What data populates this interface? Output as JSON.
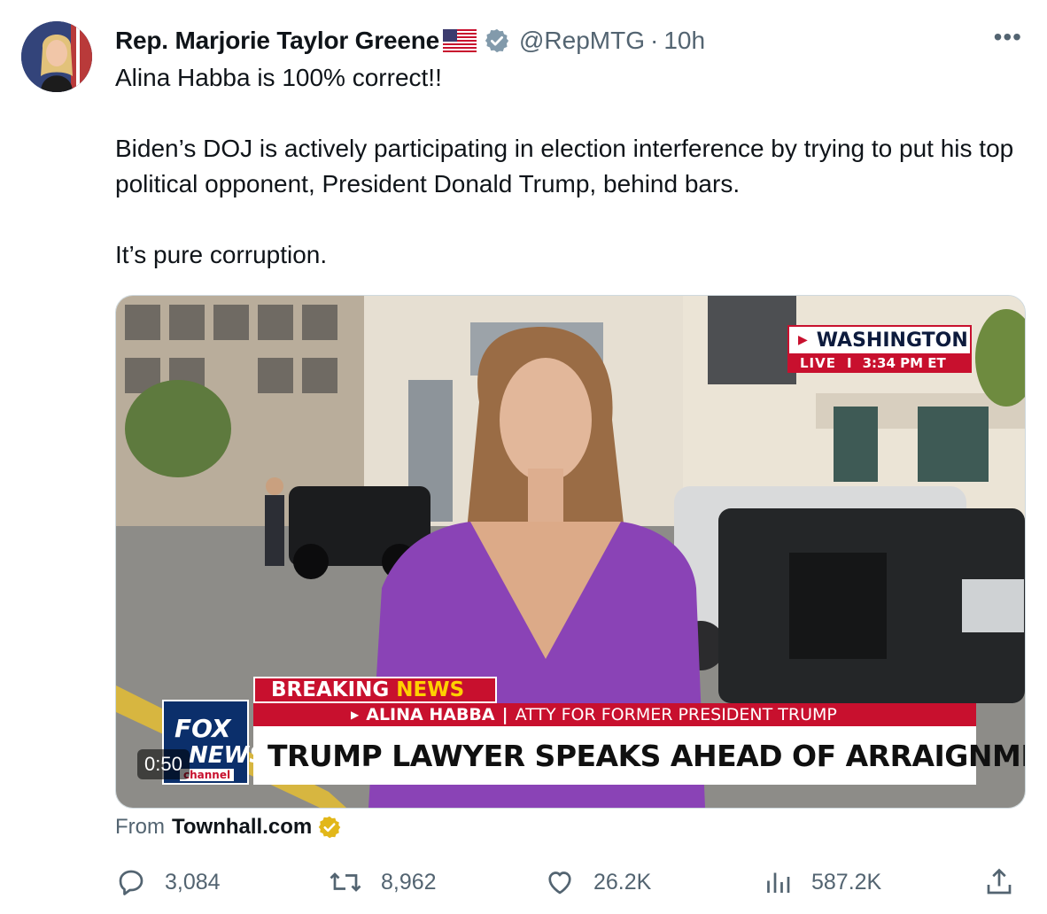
{
  "tweet": {
    "author_name": "Rep. Marjorie Taylor Greene",
    "handle": "@RepMTG",
    "separator": "·",
    "time": "10h",
    "more_label": "•••",
    "lines": [
      "Alina Habba is 100% correct!!",
      "Biden’s DOJ is actively participating in election interference by trying to put his top political opponent, President Donald Trump, behind bars.",
      "It’s pure corruption."
    ]
  },
  "video": {
    "duration": "0:50",
    "location": "WASHINGTON",
    "live_label": "LIVE",
    "live_sep": "I",
    "live_time": "3:34 PM ET",
    "breaking": "BREAKING",
    "breaking_news": "NEWS",
    "guest_name": "ALINA HABBA",
    "guest_sep": "|",
    "guest_role": "ATTY FOR FORMER PRESIDENT TRUMP",
    "headline": "TRUMP LAWYER SPEAKS AHEAD OF ARRAIGNMENT",
    "logo_fox": "FOX",
    "logo_news": "NEWS",
    "logo_channel": "channel"
  },
  "source": {
    "from_label": "From",
    "site": "Townhall.com"
  },
  "metrics": {
    "replies": "3,084",
    "reposts": "8,962",
    "likes": "26.2K",
    "views": "587.2K"
  },
  "icons": {
    "verified": "verified-badge-icon",
    "flag": "us-flag-icon",
    "reply": "reply-icon",
    "repost": "repost-icon",
    "like": "heart-icon",
    "views": "views-chart-icon",
    "share": "share-icon"
  },
  "colors": {
    "verified_blue_gray": "#829aab",
    "gold_badge": "#e2b719",
    "fox_red": "#c8102e",
    "fox_blue": "#0b2f6b",
    "muted_text": "#536471"
  }
}
